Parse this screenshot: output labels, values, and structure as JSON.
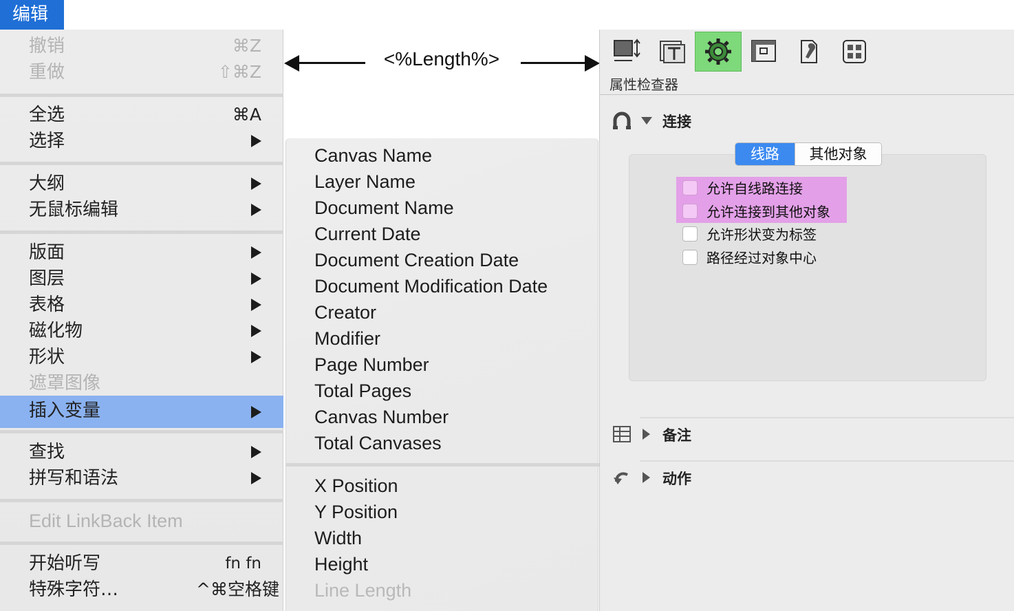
{
  "menu_title": "编辑",
  "edit_menu": {
    "undo": {
      "label": "撤销",
      "shortcut": "⌘Z"
    },
    "redo": {
      "label": "重做",
      "shortcut": "⇧⌘Z"
    },
    "select_all": {
      "label": "全选",
      "shortcut": "⌘A"
    },
    "select": {
      "label": "选择"
    },
    "outline": {
      "label": "大纲"
    },
    "mouseless_edit": {
      "label": "无鼠标编辑"
    },
    "layout": {
      "label": "版面"
    },
    "layers": {
      "label": "图层"
    },
    "table": {
      "label": "表格"
    },
    "magnets": {
      "label": "磁化物"
    },
    "shapes": {
      "label": "形状"
    },
    "mask_image": {
      "label": "遮罩图像"
    },
    "insert_variable": {
      "label": "插入变量"
    },
    "find": {
      "label": "查找"
    },
    "spelling": {
      "label": "拼写和语法"
    },
    "linkback": {
      "label": "Edit LinkBack Item"
    },
    "dictation": {
      "label": "开始听写",
      "shortcut": "fn fn"
    },
    "special_chars": {
      "label": "特殊字符…",
      "shortcut": "^⌘空格键"
    }
  },
  "variables": {
    "group1": [
      "Canvas Name",
      "Layer Name",
      "Document Name",
      "Current Date",
      "Document Creation Date",
      "Document Modification Date",
      "Creator",
      "Modifier",
      "Page Number",
      "Total Pages",
      "Canvas Number",
      "Total Canvases"
    ],
    "group2": [
      "X Position",
      "Y Position",
      "Width",
      "Height"
    ],
    "disabled": "Line Length"
  },
  "annotation": {
    "label": "<%Length%>"
  },
  "inspector": {
    "title": "属性检查器",
    "connect_section": "连接",
    "tabs": {
      "line": "线路",
      "other": "其他对象"
    },
    "checkboxes": [
      "允许自线路连接",
      "允许连接到其他对象",
      "允许形状变为标签",
      "路径经过对象中心"
    ],
    "notes_section": "备注",
    "actions_section": "动作"
  },
  "colors": {
    "menu_highlight": "#8ab2f0",
    "title_blue": "#1f6fd6",
    "active_tool": "#7ed97a",
    "checkbox_highlight": "#e3a0e8",
    "segment_on": "#3c8af0"
  }
}
